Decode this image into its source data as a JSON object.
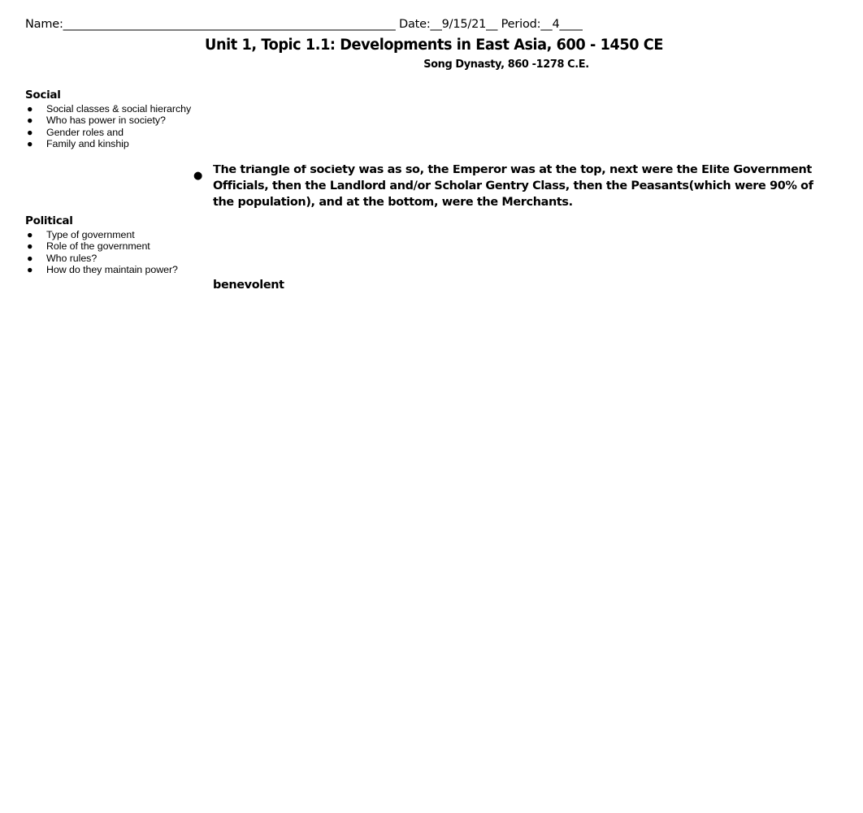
{
  "header": {
    "name_label": "Name:",
    "name_blank": "__________________________________________________________",
    "date_label": " Date:",
    "date_value": "__9/15/21__",
    "period_label": " Period:",
    "period_value": "__4____"
  },
  "title": "Unit 1, Topic 1.1: Developments in East Asia, 600 - 1450 CE",
  "subtitle": "Song Dynasty, 860 -1278 C.E.",
  "categories": [
    {
      "heading": "Social",
      "items": [
        {
          "text": "Social classes & social hierarchy",
          "trailing_blank_line": false
        },
        {
          "text": "Who has power in society?",
          "trailing_blank_line": false
        },
        {
          "text": "Gender roles and",
          "trailing_blank_line": true
        },
        {
          "text": "Family and kinship",
          "trailing_blank_line": false
        }
      ]
    },
    {
      "heading": "Political",
      "items": [
        {
          "text": "Type of government",
          "trailing_blank_line": false
        },
        {
          "text": "Role of the government",
          "trailing_blank_line": false
        },
        {
          "text": "Who rules?",
          "trailing_blank_line": false
        },
        {
          "text": "How do they maintain power?",
          "trailing_blank_line": false
        }
      ]
    }
  ],
  "content": {
    "bullet_glyph": "●",
    "paragraph": "The triangle of society was as so, the Emperor was at the top, next were the Elite Government Officials, then the Landlord and/or Scholar Gentry Class, then the Peasants(which were 90% of the population), and at the bottom, were the Merchants.",
    "note": "benevolent"
  },
  "colors": {
    "text": "#000000",
    "background": "#ffffff"
  }
}
